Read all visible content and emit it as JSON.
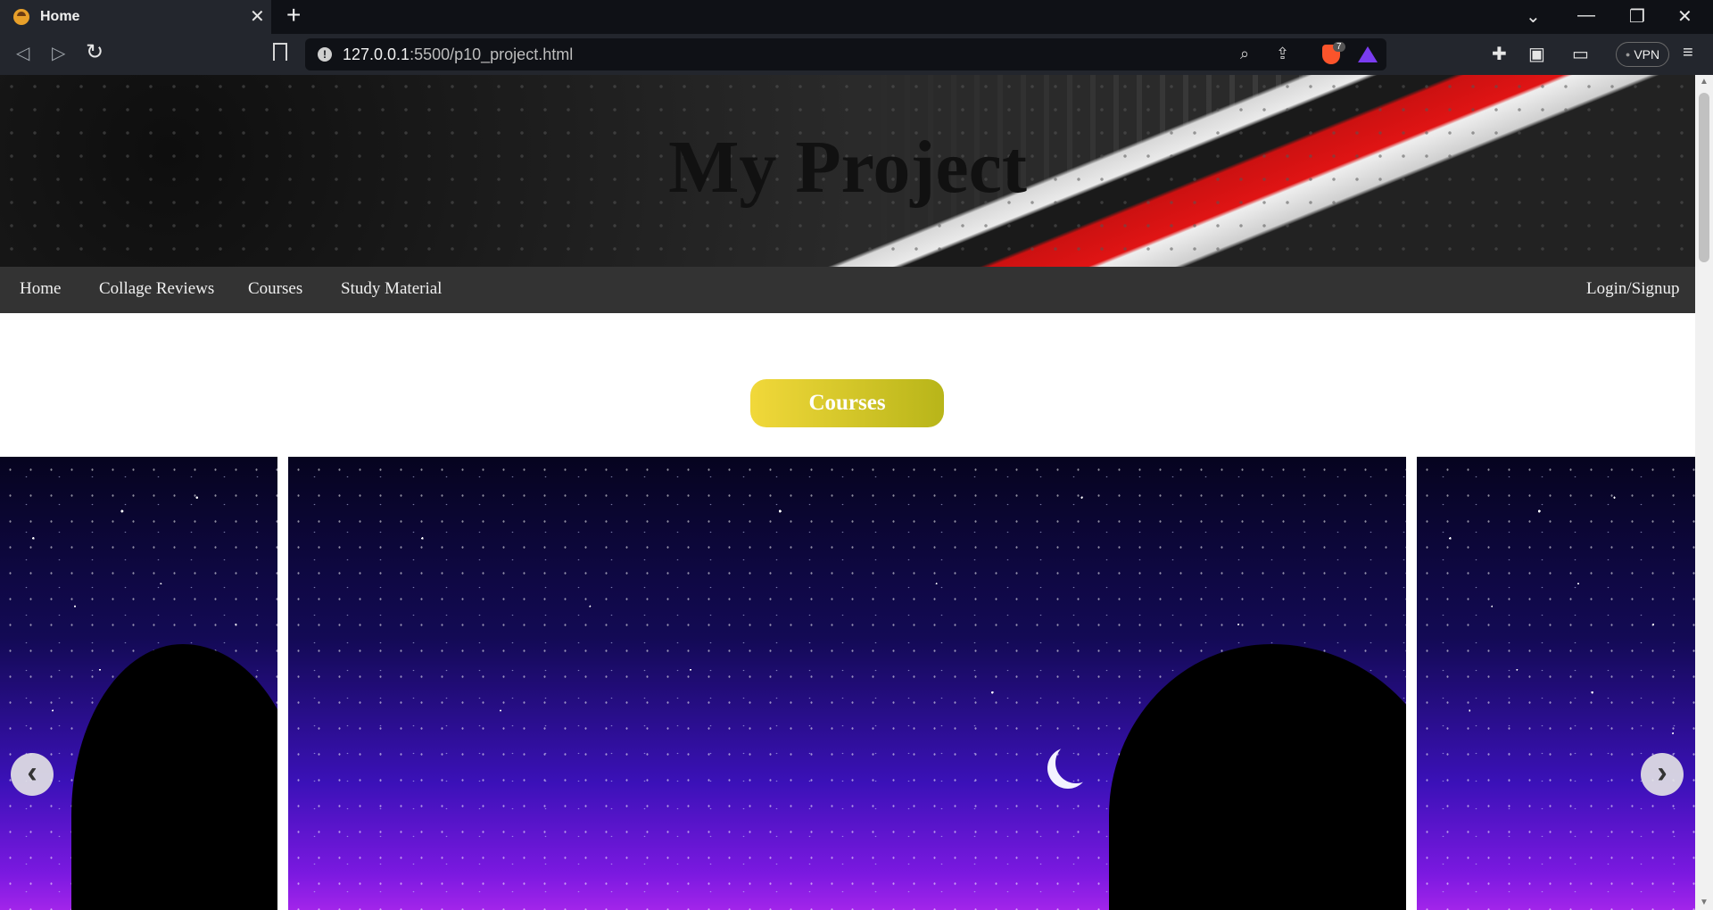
{
  "browser": {
    "tab_title": "Home",
    "tab_close": "✕",
    "new_tab": "+",
    "url_host": "127.0.0.1",
    "url_path": ":5500/p10_project.html",
    "badge_count": "7",
    "vpn_label": "VPN",
    "icons": [
      "back-icon",
      "forward-icon",
      "reload-icon",
      "bookmark-icon",
      "site-info-icon",
      "zoom-icon",
      "share-icon",
      "brave-shield-icon",
      "rewards-icon",
      "extensions-icon",
      "sidebar-icon",
      "wallet-icon",
      "menu-icon"
    ],
    "window_controls": [
      "minimize",
      "restore",
      "close"
    ]
  },
  "header": {
    "title": "My Project"
  },
  "nav": {
    "left": [
      "Home",
      "Collage Reviews",
      "Courses",
      "Study Material"
    ],
    "right": "Login/Signup"
  },
  "main": {
    "section_button": "Courses",
    "carousel": {
      "prev": "‹",
      "next": "›"
    }
  },
  "colors": {
    "navbar": "#333333",
    "button_gradient_start": "#f1d83a",
    "button_gradient_end": "#b8b519",
    "sky_top": "#06041f",
    "sky_bottom": "#a225ea"
  }
}
